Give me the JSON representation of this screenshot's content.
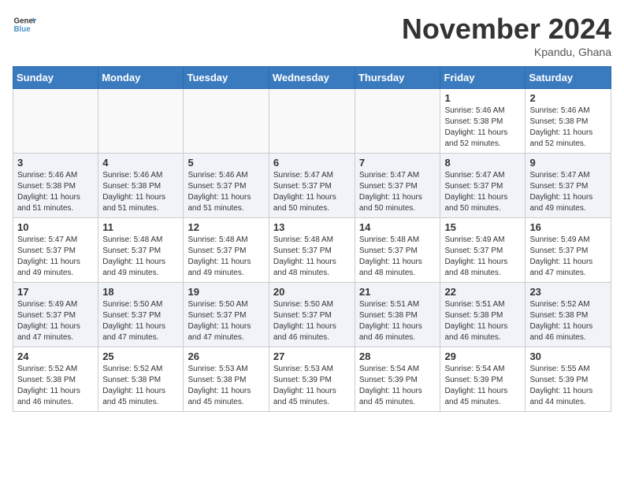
{
  "header": {
    "logo_line1": "General",
    "logo_line2": "Blue",
    "month": "November 2024",
    "location": "Kpandu, Ghana"
  },
  "weekdays": [
    "Sunday",
    "Monday",
    "Tuesday",
    "Wednesday",
    "Thursday",
    "Friday",
    "Saturday"
  ],
  "weeks": [
    [
      {
        "day": "",
        "info": ""
      },
      {
        "day": "",
        "info": ""
      },
      {
        "day": "",
        "info": ""
      },
      {
        "day": "",
        "info": ""
      },
      {
        "day": "",
        "info": ""
      },
      {
        "day": "1",
        "info": "Sunrise: 5:46 AM\nSunset: 5:38 PM\nDaylight: 11 hours\nand 52 minutes."
      },
      {
        "day": "2",
        "info": "Sunrise: 5:46 AM\nSunset: 5:38 PM\nDaylight: 11 hours\nand 52 minutes."
      }
    ],
    [
      {
        "day": "3",
        "info": "Sunrise: 5:46 AM\nSunset: 5:38 PM\nDaylight: 11 hours\nand 51 minutes."
      },
      {
        "day": "4",
        "info": "Sunrise: 5:46 AM\nSunset: 5:38 PM\nDaylight: 11 hours\nand 51 minutes."
      },
      {
        "day": "5",
        "info": "Sunrise: 5:46 AM\nSunset: 5:37 PM\nDaylight: 11 hours\nand 51 minutes."
      },
      {
        "day": "6",
        "info": "Sunrise: 5:47 AM\nSunset: 5:37 PM\nDaylight: 11 hours\nand 50 minutes."
      },
      {
        "day": "7",
        "info": "Sunrise: 5:47 AM\nSunset: 5:37 PM\nDaylight: 11 hours\nand 50 minutes."
      },
      {
        "day": "8",
        "info": "Sunrise: 5:47 AM\nSunset: 5:37 PM\nDaylight: 11 hours\nand 50 minutes."
      },
      {
        "day": "9",
        "info": "Sunrise: 5:47 AM\nSunset: 5:37 PM\nDaylight: 11 hours\nand 49 minutes."
      }
    ],
    [
      {
        "day": "10",
        "info": "Sunrise: 5:47 AM\nSunset: 5:37 PM\nDaylight: 11 hours\nand 49 minutes."
      },
      {
        "day": "11",
        "info": "Sunrise: 5:48 AM\nSunset: 5:37 PM\nDaylight: 11 hours\nand 49 minutes."
      },
      {
        "day": "12",
        "info": "Sunrise: 5:48 AM\nSunset: 5:37 PM\nDaylight: 11 hours\nand 49 minutes."
      },
      {
        "day": "13",
        "info": "Sunrise: 5:48 AM\nSunset: 5:37 PM\nDaylight: 11 hours\nand 48 minutes."
      },
      {
        "day": "14",
        "info": "Sunrise: 5:48 AM\nSunset: 5:37 PM\nDaylight: 11 hours\nand 48 minutes."
      },
      {
        "day": "15",
        "info": "Sunrise: 5:49 AM\nSunset: 5:37 PM\nDaylight: 11 hours\nand 48 minutes."
      },
      {
        "day": "16",
        "info": "Sunrise: 5:49 AM\nSunset: 5:37 PM\nDaylight: 11 hours\nand 47 minutes."
      }
    ],
    [
      {
        "day": "17",
        "info": "Sunrise: 5:49 AM\nSunset: 5:37 PM\nDaylight: 11 hours\nand 47 minutes."
      },
      {
        "day": "18",
        "info": "Sunrise: 5:50 AM\nSunset: 5:37 PM\nDaylight: 11 hours\nand 47 minutes."
      },
      {
        "day": "19",
        "info": "Sunrise: 5:50 AM\nSunset: 5:37 PM\nDaylight: 11 hours\nand 47 minutes."
      },
      {
        "day": "20",
        "info": "Sunrise: 5:50 AM\nSunset: 5:37 PM\nDaylight: 11 hours\nand 46 minutes."
      },
      {
        "day": "21",
        "info": "Sunrise: 5:51 AM\nSunset: 5:38 PM\nDaylight: 11 hours\nand 46 minutes."
      },
      {
        "day": "22",
        "info": "Sunrise: 5:51 AM\nSunset: 5:38 PM\nDaylight: 11 hours\nand 46 minutes."
      },
      {
        "day": "23",
        "info": "Sunrise: 5:52 AM\nSunset: 5:38 PM\nDaylight: 11 hours\nand 46 minutes."
      }
    ],
    [
      {
        "day": "24",
        "info": "Sunrise: 5:52 AM\nSunset: 5:38 PM\nDaylight: 11 hours\nand 46 minutes."
      },
      {
        "day": "25",
        "info": "Sunrise: 5:52 AM\nSunset: 5:38 PM\nDaylight: 11 hours\nand 45 minutes."
      },
      {
        "day": "26",
        "info": "Sunrise: 5:53 AM\nSunset: 5:38 PM\nDaylight: 11 hours\nand 45 minutes."
      },
      {
        "day": "27",
        "info": "Sunrise: 5:53 AM\nSunset: 5:39 PM\nDaylight: 11 hours\nand 45 minutes."
      },
      {
        "day": "28",
        "info": "Sunrise: 5:54 AM\nSunset: 5:39 PM\nDaylight: 11 hours\nand 45 minutes."
      },
      {
        "day": "29",
        "info": "Sunrise: 5:54 AM\nSunset: 5:39 PM\nDaylight: 11 hours\nand 45 minutes."
      },
      {
        "day": "30",
        "info": "Sunrise: 5:55 AM\nSunset: 5:39 PM\nDaylight: 11 hours\nand 44 minutes."
      }
    ]
  ]
}
